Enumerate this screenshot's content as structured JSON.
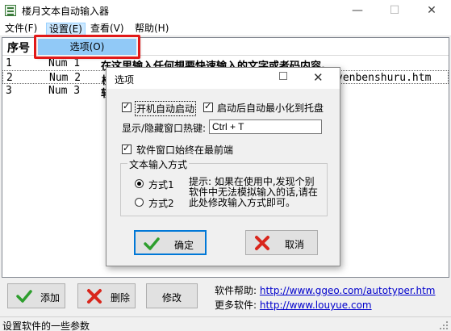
{
  "window": {
    "title": "楼月文本自动输入器",
    "min_glyph": "—",
    "max_glyph": "☐",
    "close_glyph": "✕"
  },
  "menu": {
    "file": "文件(F)",
    "settings": "设置(E)",
    "view": "查看(V)",
    "help": "帮助(H)"
  },
  "dropdown": {
    "options_item": "选项(O)"
  },
  "list": {
    "header_seq": "序号",
    "rows": [
      {
        "seq": "1",
        "key": "Num 1",
        "text": "在这里输入任何想要快速输入的文字或者码内容。",
        "text_right": ""
      },
      {
        "seq": "2",
        "key": "Num 2",
        "text": "楼",
        "text_right": "venbenshuru.htm"
      },
      {
        "seq": "3",
        "key": "Num 3",
        "text": "软",
        "text_right": ""
      }
    ]
  },
  "dialog": {
    "title": "选项",
    "auto_start_label": "开机自动启动",
    "auto_start_checked": true,
    "minimize_tray_label": "启动后自动最小化到托盘",
    "minimize_tray_checked": true,
    "hotkey_label": "显示/隐藏窗口热键:",
    "hotkey_value": "Ctrl + T",
    "always_top_label": "软件窗口始终在最前端",
    "always_top_checked": true,
    "input_mode_group": "文本输入方式",
    "mode1_label": "方式1",
    "mode2_label": "方式2",
    "selected_mode": "方式1",
    "hint_text": "提示: 如果在使用中,发现个别软件中无法模拟输入的话,请在此处修改输入方式即可。",
    "ok_label": "确定",
    "cancel_label": "取消"
  },
  "bottom": {
    "add_label": "添加",
    "delete_label": "删除",
    "edit_label": "修改",
    "help_prefix": "软件帮助:",
    "help_link": "http://www.ggeo.com/autotyper.htm",
    "more_prefix": "更多软件:",
    "more_link": "http://www.louyue.com"
  },
  "status": {
    "text": "设置软件的一些参数"
  },
  "colors": {
    "highlight_red": "#e11818",
    "menu_selected": "#91c9f7",
    "link": "#0000cc",
    "accent": "#0078d7"
  }
}
